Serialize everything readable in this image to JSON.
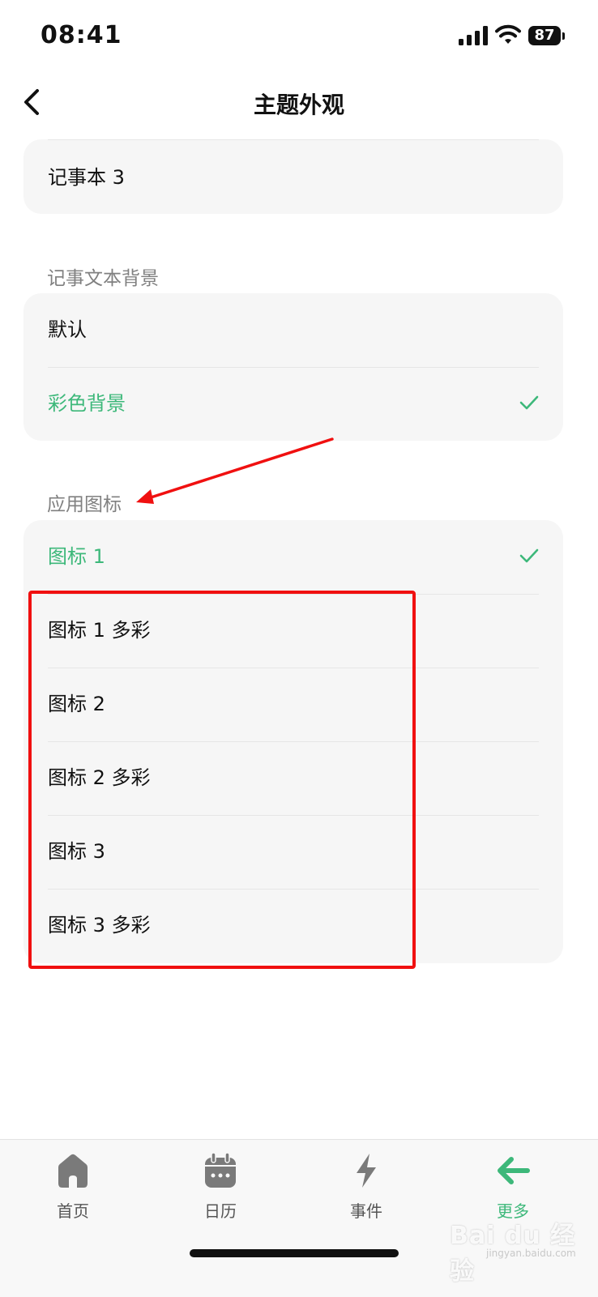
{
  "status_bar": {
    "time": "08:41",
    "battery": "87"
  },
  "nav": {
    "title": "主题外观"
  },
  "notebook_section": {
    "items": [
      {
        "label": "记事本 3"
      }
    ]
  },
  "text_background_section": {
    "title": "记事文本背景",
    "items": [
      {
        "label": "默认",
        "selected": false
      },
      {
        "label": "彩色背景",
        "selected": true
      }
    ]
  },
  "app_icon_section": {
    "title": "应用图标",
    "items": [
      {
        "label": "图标 1",
        "selected": true
      },
      {
        "label": "图标 1 多彩",
        "selected": false
      },
      {
        "label": "图标 2",
        "selected": false
      },
      {
        "label": "图标 2 多彩",
        "selected": false
      },
      {
        "label": "图标 3",
        "selected": false
      },
      {
        "label": "图标 3 多彩",
        "selected": false
      }
    ]
  },
  "tab_bar": {
    "tabs": [
      {
        "label": "首页",
        "icon": "home-icon",
        "active": false
      },
      {
        "label": "日历",
        "icon": "calendar-icon",
        "active": false
      },
      {
        "label": "事件",
        "icon": "lightning-icon",
        "active": false
      },
      {
        "label": "更多",
        "icon": "arrow-left-icon",
        "active": true
      }
    ]
  },
  "watermark": {
    "brand": "Bai du 经验",
    "url": "jingyan.baidu.com"
  },
  "colors": {
    "accent": "#3db87a",
    "card_bg": "#f6f6f6",
    "annotation_red": "#f01010",
    "icon_gray": "#7a7a7a"
  }
}
